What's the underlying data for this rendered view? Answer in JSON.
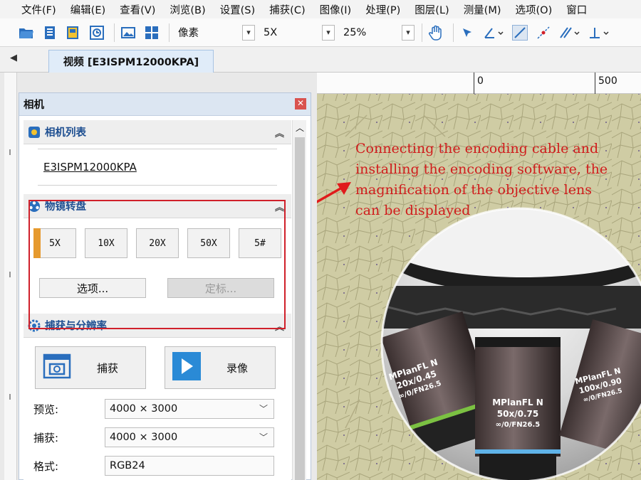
{
  "menu": [
    "文件(F)",
    "编辑(E)",
    "查看(V)",
    "浏览(B)",
    "设置(S)",
    "捕获(C)",
    "图像(I)",
    "处理(P)",
    "图层(L)",
    "测量(M)",
    "选项(O)",
    "窗口"
  ],
  "toolbar": {
    "unit": "像素",
    "objective": "5X",
    "zoom": "25%"
  },
  "tabs": {
    "active": "视频 [E3ISPM12000KPA]"
  },
  "ruler": {
    "h_ticks": [
      "0",
      "500"
    ]
  },
  "panel": {
    "title": "相机",
    "camera_list": {
      "header": "相机列表",
      "camera": "E3ISPM12000KPA"
    },
    "objective_turret": {
      "header": "物镜转盘",
      "buttons": [
        "5X",
        "10X",
        "20X",
        "50X",
        "5#"
      ],
      "active_index": 0,
      "options_label": "选项...",
      "calibrate_label": "定标..."
    },
    "capture": {
      "header": "捕获与分辨率",
      "capture_label": "捕获",
      "record_label": "录像",
      "rows": [
        {
          "label": "预览:",
          "value": "4000 × 3000"
        },
        {
          "label": "捕获:",
          "value": "4000 × 3000"
        },
        {
          "label": "格式:",
          "value": "RGB24"
        }
      ]
    }
  },
  "annotation": {
    "text_lines": [
      "Connecting the encoding cable and",
      "installing the encoding software, the",
      "magnification of the objective lens",
      "can be displayed"
    ]
  },
  "lenses": [
    {
      "line1": "MPlanFL N",
      "line2": "20x/0.45",
      "line3": "∞/0/FN26.5"
    },
    {
      "line1": "MPlanFL N",
      "line2": "50x/0.75",
      "line3": "∞/0/FN26.5"
    },
    {
      "line1": "MPlanFL N",
      "line2": "100x/0.90",
      "line3": "∞/0/FN26.5"
    }
  ],
  "colors": {
    "accent_active": "#e69a2e",
    "highlight_box": "#d0202a",
    "annotation_text": "#d01c1c",
    "header_blue": "#1e4f91"
  }
}
